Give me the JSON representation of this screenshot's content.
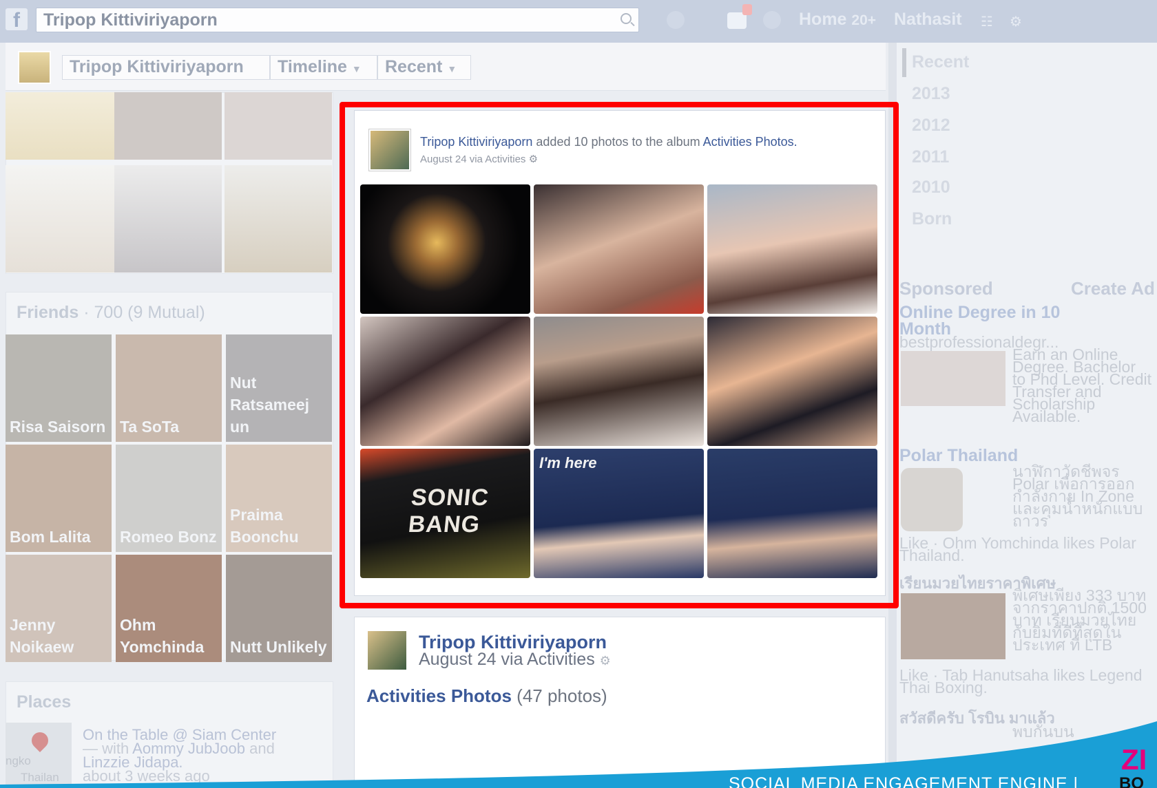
{
  "topbar": {
    "logo": "f",
    "search_value": "Tripop Kittiviriyaporn",
    "home_label": "Home",
    "home_count": "20+",
    "user_name": "Nathasit"
  },
  "breadcrumb": {
    "name": "Tripop Kittiviriyaporn",
    "timeline": "Timeline",
    "recent": "Recent"
  },
  "friends": {
    "title": "Friends",
    "count": "· 700 (9 Mutual)",
    "items": [
      {
        "name": "Risa Saisorn"
      },
      {
        "name": "Ta SoTa"
      },
      {
        "name": "Nut Ratsameej un"
      },
      {
        "name": "Bom Lalita"
      },
      {
        "name": "Romeo Bonz"
      },
      {
        "name": "Praima Boonchu"
      },
      {
        "name": "Jenny Noikaew"
      },
      {
        "name": "Ohm Yomchinda"
      },
      {
        "name": "Nutt Unlikely"
      }
    ]
  },
  "places": {
    "title": "Places",
    "place_name": "On the Table @ Siam Center",
    "with_text": "— with",
    "with_names": "Aommy JubJoob",
    "and_text": "and",
    "with_names_2": "Linzzie Jidapa.",
    "time": "about 3 weeks ago",
    "map_label_1": "ngko",
    "map_label_2": "Thailan"
  },
  "story": {
    "author": "Tripop Kittiviriyaporn",
    "action": "added 10 photos to the album",
    "album": "Activities Photos.",
    "date": "August 24 via Activities",
    "photo_captions": [
      "SONIC BANG",
      "I'm here",
      "I'm here"
    ]
  },
  "card2": {
    "author": "Tripop Kittiviriyaporn",
    "date": "August 24 via Activities",
    "album": "Activities Photos",
    "count": "(47 photos)"
  },
  "timeline_years": [
    "Recent",
    "2013",
    "2012",
    "2011",
    "2010",
    "Born"
  ],
  "sponsored": {
    "title": "Sponsored",
    "create_ad": "Create Ad",
    "ads": [
      {
        "title": "Online Degree in 10 Month",
        "url": "bestprofessionaldegr...",
        "body": "Earn an Online Degree. Bachelor to Phd Level. Credit Transfer and Scholarship Available."
      },
      {
        "title": "Polar Thailand",
        "body": "นาฬิกาวัดชีพจร Polar เพื่อการออกกำลังกาย In Zone และคุมน้ำหนักแบบถาวร",
        "like": "Like · Ohm Yomchinda likes Polar Thailand."
      },
      {
        "title": "เรียนมวยไทยราคาพิเศษ",
        "body": "พิเศษเพียง 333 บาท จากราคาปกติ 1500 บาท เรียนมวยไทยกับยิมที่ดีที่สุดในประเทศ ที่ LTB",
        "like": "Like · Tab Hanutsaha likes Legend Thai Boxing."
      },
      {
        "title": "สวัสดีครับ โรบิน มาแล้ว",
        "body": "พบกันบน"
      }
    ]
  },
  "footer": {
    "tagline": "SOCIAL MEDIA ENGAGEMENT ENGINE |",
    "brand_top": "ZI",
    "brand_bottom": "BO"
  },
  "colors": {
    "highlight": "#ff0000",
    "link": "#3b5998",
    "wave": "#1a9fd6"
  }
}
